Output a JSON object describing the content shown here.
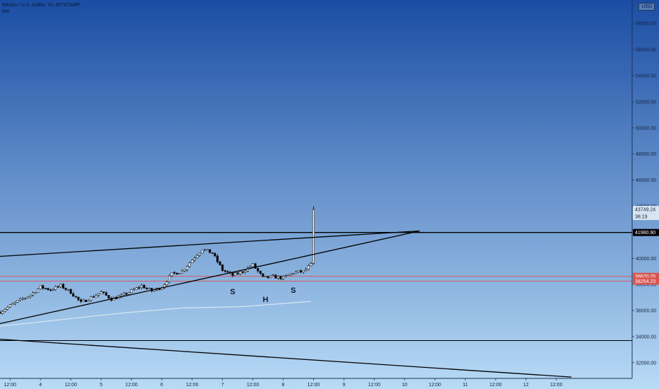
{
  "header": {
    "symbol_line": "Bitcoin / U.S. Dollar, 1h, BITSTAMP",
    "indicator": "MA"
  },
  "currency_badge": "USD",
  "colors": {
    "background_top": "#1a4da3",
    "background_bottom": "#b8dbf6",
    "candle_up": "#ffffff",
    "candle_down": "#000000",
    "trendline": "#000000",
    "support_level": "#d9534f",
    "moving_average": "#d9e6ef"
  },
  "chart_data": {
    "type": "candlestick",
    "title": "Bitcoin / U.S. Dollar, 1h, BITSTAMP",
    "ylim": [
      30800,
      59800
    ],
    "y_ticks": [
      58000,
      56000,
      54000,
      52000,
      50000,
      48000,
      46000,
      44000,
      42000,
      40000,
      38000,
      36000,
      34000,
      32000
    ],
    "y_tick_labels": [
      "58000.00",
      "56000.00",
      "54000.00",
      "52000.00",
      "50000.00",
      "48000.00",
      "46000.00",
      "44000.00",
      "42000.00",
      "40000.00",
      "38000.00",
      "36000.00",
      "34000.00",
      "32000.00"
    ],
    "x_range": [
      "Aug 3 08:00",
      "Aug 13 18:00"
    ],
    "x_ticks": [
      {
        "t": "Aug 3 12:00",
        "label": "12:00"
      },
      {
        "t": "Aug 4 00:00",
        "label": "4"
      },
      {
        "t": "Aug 4 12:00",
        "label": "12:00"
      },
      {
        "t": "Aug 5 00:00",
        "label": "5"
      },
      {
        "t": "Aug 5 12:00",
        "label": "12:00"
      },
      {
        "t": "Aug 6 00:00",
        "label": "6"
      },
      {
        "t": "Aug 6 12:00",
        "label": "12:00"
      },
      {
        "t": "Aug 7 00:00",
        "label": "7"
      },
      {
        "t": "Aug 7 12:00",
        "label": "12:00"
      },
      {
        "t": "Aug 8 00:00",
        "label": "8"
      },
      {
        "t": "Aug 8 12:00",
        "label": "12:00"
      },
      {
        "t": "Aug 9 00:00",
        "label": "9"
      },
      {
        "t": "Aug 9 12:00",
        "label": "12:00"
      },
      {
        "t": "Aug 10 00:00",
        "label": "10"
      },
      {
        "t": "Aug 10 12:00",
        "label": "12:00"
      },
      {
        "t": "Aug 11 00:00",
        "label": "11"
      },
      {
        "t": "Aug 11 12:00",
        "label": "12:00"
      },
      {
        "t": "Aug 12 00:00",
        "label": "12"
      },
      {
        "t": "Aug 12 12:00",
        "label": "12:00"
      }
    ],
    "close_path": [
      [
        "Aug 3 08:00",
        35900
      ],
      [
        "Aug 3 14:00",
        36600
      ],
      [
        "Aug 3 20:00",
        37200
      ],
      [
        "Aug 4 00:00",
        37800
      ],
      [
        "Aug 4 04:00",
        37600
      ],
      [
        "Aug 4 08:00",
        37900
      ],
      [
        "Aug 4 12:00",
        37400
      ],
      [
        "Aug 4 16:00",
        36600
      ],
      [
        "Aug 4 20:00",
        37000
      ],
      [
        "Aug 5 00:00",
        37400
      ],
      [
        "Aug 5 04:00",
        36900
      ],
      [
        "Aug 5 08:00",
        37100
      ],
      [
        "Aug 5 12:00",
        37500
      ],
      [
        "Aug 5 16:00",
        37900
      ],
      [
        "Aug 5 20:00",
        37500
      ],
      [
        "Aug 6 00:00",
        37800
      ],
      [
        "Aug 6 04:00",
        38800
      ],
      [
        "Aug 6 08:00",
        39000
      ],
      [
        "Aug 6 12:00",
        39900
      ],
      [
        "Aug 6 16:00",
        40700
      ],
      [
        "Aug 6 20:00",
        40400
      ],
      [
        "Aug 7 00:00",
        39100
      ],
      [
        "Aug 7 04:00",
        38700
      ],
      [
        "Aug 7 08:00",
        39000
      ],
      [
        "Aug 7 12:00",
        39500
      ],
      [
        "Aug 7 16:00",
        38500
      ],
      [
        "Aug 7 20:00",
        38600
      ],
      [
        "Aug 8 00:00",
        38500
      ],
      [
        "Aug 8 04:00",
        38900
      ],
      [
        "Aug 8 08:00",
        39000
      ],
      [
        "Aug 8 11:00",
        39500
      ],
      [
        "Aug 8 12:00",
        43500
      ]
    ],
    "moving_average": [
      [
        "Aug 3 08:00",
        34800
      ],
      [
        "Aug 4 08:00",
        35300
      ],
      [
        "Aug 5 08:00",
        35800
      ],
      [
        "Aug 6 08:00",
        36200
      ],
      [
        "Aug 7 08:00",
        36300
      ],
      [
        "Aug 8 11:00",
        36700
      ]
    ],
    "horizontal_levels": [
      {
        "value": 41980.9,
        "label": "41980.90",
        "color": "#000000"
      },
      {
        "value": 38620.25,
        "label": "38620.25",
        "color": "#d9534f"
      },
      {
        "value": 38254.23,
        "label": "38254.23",
        "color": "#d9534f"
      },
      {
        "value": 33700,
        "color": "#000000"
      }
    ],
    "trendlines": [
      {
        "from": [
          "Aug 3 08:00",
          40150
        ],
        "to": [
          "Aug 10 06:00",
          42100
        ]
      },
      {
        "from": [
          "Aug 3 08:00",
          35000
        ],
        "to": [
          "Aug 10 06:00",
          42100
        ]
      },
      {
        "from": [
          "Aug 3 08:00",
          33800
        ],
        "to": [
          "Aug 12 18:00",
          30900
        ]
      }
    ],
    "last_price": {
      "value": 43749.24,
      "label": "43749.24",
      "countdown": "36:19"
    },
    "annotations": [
      {
        "text": "S",
        "x": "Aug 7 04:00",
        "y": 37250
      },
      {
        "text": "H",
        "x": "Aug 7 17:00",
        "y": 36650
      },
      {
        "text": "S",
        "x": "Aug 8 04:00",
        "y": 37350
      }
    ]
  }
}
